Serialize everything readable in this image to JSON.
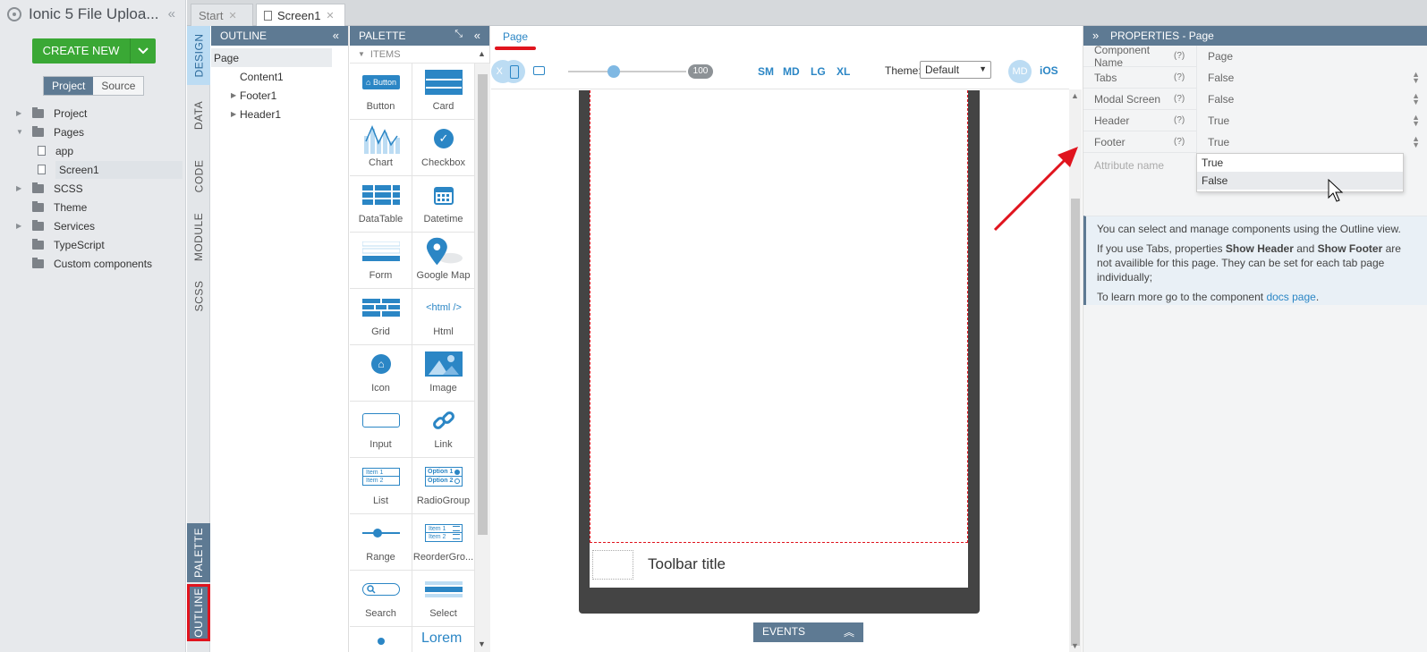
{
  "project": {
    "title": "Ionic 5 File Uploa...",
    "create_button": "CREATE NEW",
    "view_toggle": [
      "Project",
      "Source"
    ],
    "tree": [
      {
        "label": "Project",
        "type": "folder",
        "indent": 0,
        "expand": "collapsed"
      },
      {
        "label": "Pages",
        "type": "folder",
        "indent": 0,
        "expand": "expanded"
      },
      {
        "label": "app",
        "type": "file",
        "indent": 1
      },
      {
        "label": "Screen1",
        "type": "file",
        "indent": 1,
        "selected": true
      },
      {
        "label": "SCSS",
        "type": "folder",
        "indent": 0,
        "expand": "collapsed"
      },
      {
        "label": "Theme",
        "type": "folder",
        "indent": 0
      },
      {
        "label": "Services",
        "type": "folder",
        "indent": 0,
        "expand": "collapsed"
      },
      {
        "label": "TypeScript",
        "type": "folder",
        "indent": 0
      },
      {
        "label": "Custom components",
        "type": "folder",
        "indent": 0
      }
    ]
  },
  "vertical_tabs": [
    "DESIGN",
    "DATA",
    "CODE",
    "MODULE",
    "SCSS",
    "PALETTE",
    "OUTLINE"
  ],
  "file_tabs": {
    "start": "Start",
    "screen": "Screen1"
  },
  "outline": {
    "title": "OUTLINE",
    "root": "Page",
    "children": [
      {
        "label": "Content1",
        "expand": "none"
      },
      {
        "label": "Footer1",
        "expand": "collapsed"
      },
      {
        "label": "Header1",
        "expand": "collapsed"
      }
    ]
  },
  "palette": {
    "title": "PALETTE",
    "section": "ITEMS",
    "items": [
      "Button",
      "Card",
      "Chart",
      "Checkbox",
      "DataTable",
      "Datetime",
      "Form",
      "Google Map",
      "Grid",
      "Html",
      "Icon",
      "Image",
      "Input",
      "Link",
      "List",
      "RadioGroup",
      "Range",
      "ReorderGro...",
      "Search",
      "Select"
    ],
    "icon_text": {
      "button": "Button",
      "html": "<html />",
      "list_item1": "Item 1",
      "list_item2": "Item 2",
      "radio_option1": "Option 1",
      "radio_option2": "Option 2",
      "reorder_item1": "Item 1",
      "reorder_item2": "Item 2",
      "lorem": "Lorem"
    }
  },
  "canvas": {
    "page_tab": "Page",
    "zoom": "100",
    "breakpoints": [
      "XS",
      "SM",
      "MD",
      "LG",
      "XL"
    ],
    "theme_label": "Theme:",
    "theme_value": "Default",
    "platform_md": "MD",
    "platform_ios": "iOS",
    "toolbar_title": "Toolbar title",
    "events_label": "EVENTS"
  },
  "properties": {
    "title": "PROPERTIES - Page",
    "help_marker": "(?)",
    "rows": [
      {
        "name": "Component Name",
        "value": "Page"
      },
      {
        "name": "Tabs",
        "value": "False"
      },
      {
        "name": "Modal Screen",
        "value": "False"
      },
      {
        "name": "Header",
        "value": "True"
      },
      {
        "name": "Footer",
        "value": "True"
      }
    ],
    "attribute_placeholder": "Attribute name",
    "dropdown_options": [
      "True",
      "False"
    ],
    "info": {
      "line1": "You can select and manage components using the Outline view.",
      "line2_a": "If you use Tabs, properties ",
      "line2_b": "Show Header",
      "line2_c": " and ",
      "line2_d": "Show Footer",
      "line2_e": " are not availible for this page. They can be set for each tab page individually;",
      "line3_a": "To learn more go to the component ",
      "line3_link": "docs page",
      "line3_b": "."
    }
  },
  "colors": {
    "accent_blue": "#2b86c5",
    "panel_header": "#5e7a93",
    "create_green": "#3aa835",
    "highlight_red": "#e0141e"
  }
}
